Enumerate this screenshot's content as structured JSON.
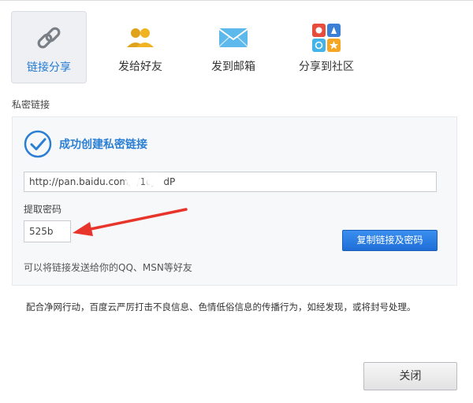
{
  "tabs": [
    {
      "label": "链接分享",
      "icon": "link-icon",
      "active": true
    },
    {
      "label": "发给好友",
      "icon": "friends-icon",
      "active": false
    },
    {
      "label": "发到邮箱",
      "icon": "mail-icon",
      "active": false
    },
    {
      "label": "分享到社区",
      "icon": "community-icon",
      "active": false
    }
  ],
  "section": {
    "title": "私密链接"
  },
  "success": {
    "message": "成功创建私密链接",
    "icon": "check-circle-icon"
  },
  "link": {
    "value": "http://pan.baidu.com/s/1oJ   dP"
  },
  "password": {
    "label": "提取密码",
    "value": "525b"
  },
  "buttons": {
    "copy": "复制链接及密码",
    "close": "关闭"
  },
  "hint": "可以将链接发送给你的QQ、MSN等好友",
  "notice": "配合净网行动，百度云严厉打击不良信息、色情低俗信息的传播行为，如经发现，或将封号处理。",
  "colors": {
    "accent": "#2a7fd4",
    "button_blue": "#1f6ed6",
    "arrow_red": "#e8352b"
  }
}
